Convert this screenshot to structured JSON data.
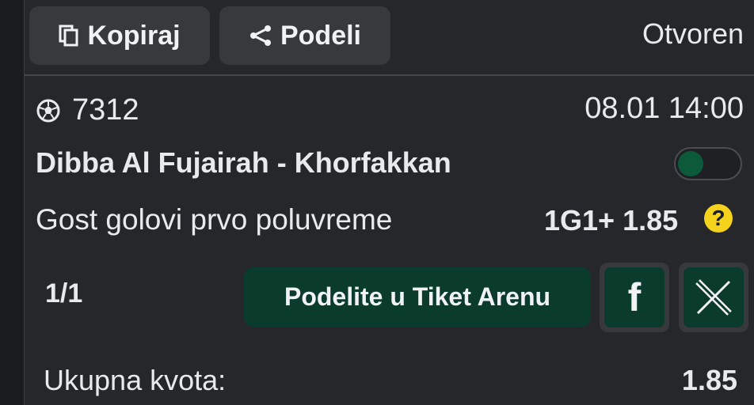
{
  "toolbar": {
    "copy_label": "Kopiraj",
    "share_label": "Podeli",
    "status": "Otvoren"
  },
  "event": {
    "id": "7312",
    "datetime": "08.01 14:00",
    "teams": "Dibba Al Fujairah - Khorfakkan",
    "market": "Gost golovi prvo poluvreme",
    "pick": "1G1+",
    "odds": "1.85",
    "help_glyph": "?"
  },
  "ticket": {
    "count": "1/1",
    "share_arena_label": "Podelite u Tiket Arenu",
    "facebook_glyph": "f"
  },
  "total": {
    "label": "Ukupna kvota:",
    "value": "1.85"
  },
  "colors": {
    "accent_green": "#0b3b2a",
    "toggle_knob": "#0d5a3b",
    "help_yellow": "#f5d21c",
    "card_bg": "#25272a"
  },
  "icons": [
    "copy-icon",
    "share-icon",
    "soccer-ball-icon",
    "help-icon",
    "facebook-icon",
    "x-icon"
  ]
}
